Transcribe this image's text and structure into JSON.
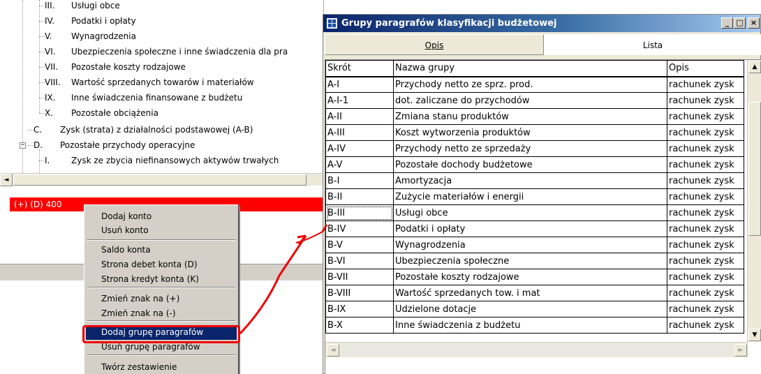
{
  "tree": {
    "nodes": [
      {
        "num": "III.",
        "label": "Usługi obce"
      },
      {
        "num": "IV.",
        "label": "Podatki i opłaty"
      },
      {
        "num": "V.",
        "label": "Wynagrodzenia"
      },
      {
        "num": "VI.",
        "label": "Ubezpieczenia społeczne i inne świadczenia dla pra"
      },
      {
        "num": "VII.",
        "label": "Pozostałe koszty rodzajowe"
      },
      {
        "num": "VIII.",
        "label": "Wartość sprzedanych towarów i materiałów"
      },
      {
        "num": "IX.",
        "label": "Inne świadczenia finansowane z budżetu"
      },
      {
        "num": "X.",
        "label": "Pozostałe obciążenia"
      },
      {
        "num": "C.",
        "label": "Zysk (strata) z działalności podstawowej (A-B)"
      },
      {
        "num": "D.",
        "label": "Pozostałe przychody operacyjne"
      },
      {
        "num": "I.",
        "label": "Zysk ze zbycia niefinansowych aktywów trwałych"
      }
    ],
    "expander_symbol": "−",
    "scroll_left_glyph": "◄"
  },
  "account": {
    "label": "(+) (D) 400"
  },
  "context_menu": {
    "items": [
      "Dodaj konto",
      "Usuń konto",
      "Saldo konta",
      "Strona debet konta (D)",
      "Strona kredyt konta (K)",
      "Zmień znak na (+)",
      "Zmień znak na (-)",
      "Dodaj grupę paragrafów",
      "Usuń grupę paragrafów",
      "Twórz zestawienie"
    ],
    "selected": "Dodaj grupę paragrafów"
  },
  "dialog": {
    "title": "Grupy paragrafów klasyfikacji budżetowej",
    "btn_min": "_",
    "btn_max": "□",
    "btn_close": "×",
    "tabs": {
      "opis": "Opis",
      "lista": "Lista"
    },
    "columns": [
      "Skrót",
      "Nazwa grupy",
      "Opis"
    ],
    "rows": [
      {
        "code": "A-I",
        "name": "Przychody netto ze sprz. prod.",
        "desc": "rachunek zysk"
      },
      {
        "code": "A-I-1",
        "name": "dot. zaliczane do przychodów",
        "desc": "rachunek zysk"
      },
      {
        "code": "A-II",
        "name": "Zmiana stanu produktów",
        "desc": "rachunek zysk"
      },
      {
        "code": "A-III",
        "name": "Koszt wytworzenia produktów",
        "desc": "rachunek zysk"
      },
      {
        "code": "A-IV",
        "name": "Przychody netto ze sprzedaży",
        "desc": "rachunek zysk"
      },
      {
        "code": "A-V",
        "name": "Pozostałe dochody budżetowe",
        "desc": "rachunek zysk"
      },
      {
        "code": "B-I",
        "name": "Amortyzacja",
        "desc": "rachunek zysk"
      },
      {
        "code": "B-II",
        "name": "Zużycie materiałów i energii",
        "desc": "rachunek zysk"
      },
      {
        "code": "B-III",
        "name": "Usługi obce",
        "desc": "rachunek zysk"
      },
      {
        "code": "B-IV",
        "name": "Podatki i opłaty",
        "desc": "rachunek zysk"
      },
      {
        "code": "B-V",
        "name": "Wynagrodzenia",
        "desc": "rachunek zysk"
      },
      {
        "code": "B-VI",
        "name": "Ubezpieczenia społeczne",
        "desc": "rachunek zysk"
      },
      {
        "code": "B-VII",
        "name": "Pozostałe koszty rodzajowe",
        "desc": "rachunek zysk"
      },
      {
        "code": "B-VIII",
        "name": "Wartość sprzedanych tow. i mat",
        "desc": "rachunek zysk"
      },
      {
        "code": "B-IX",
        "name": "Udzielone dotacje",
        "desc": "rachunek zysk"
      },
      {
        "code": "B-X",
        "name": "Inne świadczenia z budżetu",
        "desc": "rachunek zysk"
      }
    ],
    "current_row": "B-III",
    "scroll_up_glyph": "▲",
    "scroll_down_glyph": "▼",
    "scroll_left_glyph": "◄",
    "scroll_right_glyph": "►"
  },
  "colors": {
    "selected_account": "#ff0000",
    "menu_highlight": "#0a246a",
    "annotation": "#ee0000"
  }
}
